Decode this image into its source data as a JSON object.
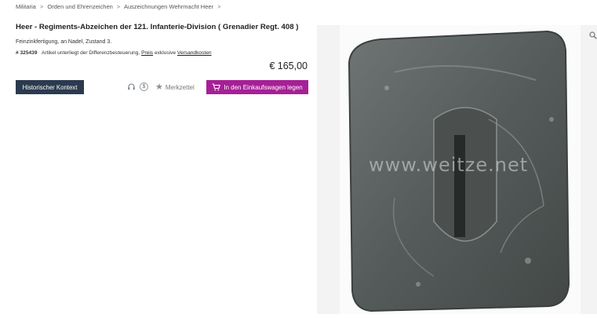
{
  "breadcrumb": [
    "Militaria",
    "Orden und Ehrenzeichen",
    "Auszeichnungen Wehrmacht Heer"
  ],
  "breadcrumb_sep": ">",
  "product": {
    "title": "Heer - Regiments-Abzeichen der 121. Infanterie-Division ( Grenadier Regt. 408 )",
    "description": "Feinzinkfertigung, an Nadel, Zustand 3.",
    "article_number": "# 325439",
    "vat_note": "Artikel unterliegt der Differenzbesteuerung,",
    "price_link": "Preis",
    "vat_middle": "exklusive",
    "shipping_link": "Versandkosten",
    "price": "€ 165,00"
  },
  "actions": {
    "history_label": "Historischer Kontext",
    "dollar_glyph": "$",
    "wishlist_label": "Merkzettel",
    "cart_label": "In den Einkaufswagen legen"
  },
  "image": {
    "watermark": "www.weitze.net"
  },
  "colors": {
    "history_button": "#2b3a4e",
    "cart_button": "#a61f96",
    "badge_metal": "#5a605f"
  },
  "icons": [
    "headset-icon",
    "dollar-icon",
    "star-icon",
    "cart-icon",
    "zoom-icon"
  ]
}
